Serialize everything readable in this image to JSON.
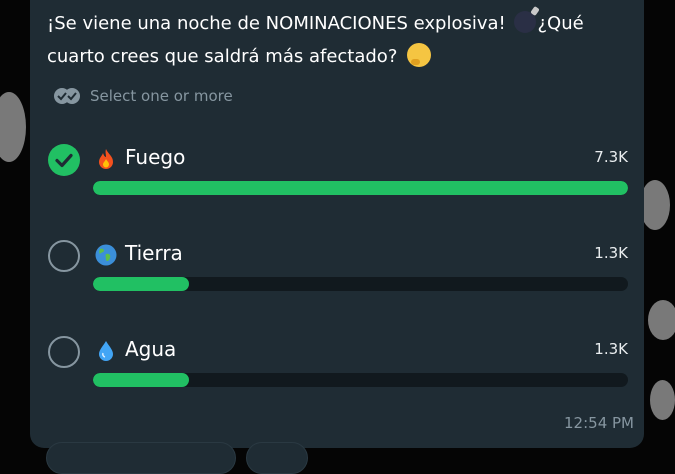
{
  "poll": {
    "question": {
      "part1": "¡Se viene una noche de NOMINACIONES explosiva! ",
      "part2": "¿Qué cuarto crees que saldrá más afectado? "
    },
    "hint": "Select one or more",
    "options": [
      {
        "label": "Fuego",
        "count": "7.3K",
        "selected": true,
        "fill_fraction": 1.0,
        "icon": "fire-emoji"
      },
      {
        "label": "Tierra",
        "count": "1.3K",
        "selected": false,
        "fill_fraction": 0.18,
        "icon": "globe-emoji"
      },
      {
        "label": "Agua",
        "count": "1.3K",
        "selected": false,
        "fill_fraction": 0.18,
        "icon": "droplet-emoji"
      }
    ],
    "timestamp": "12:54 PM"
  },
  "colors": {
    "card": "#1f2c34",
    "accent_green": "#21c063",
    "muted_text": "#8696a0",
    "bar_track": "#11191e"
  }
}
